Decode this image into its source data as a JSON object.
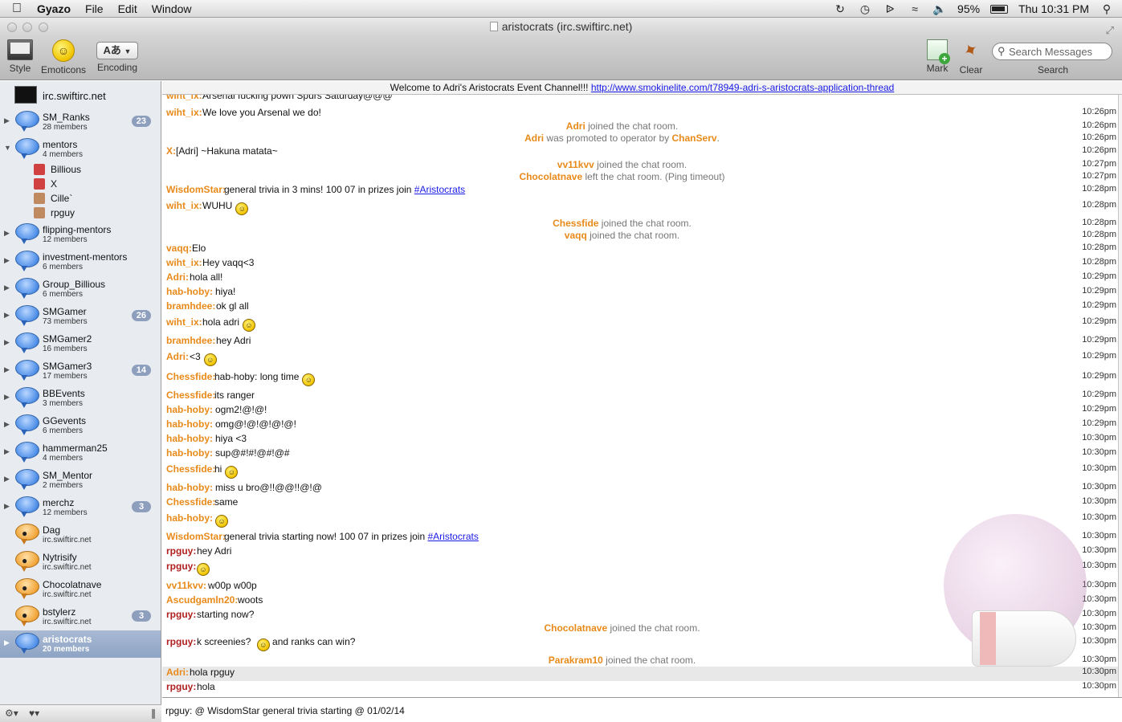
{
  "menubar": {
    "app": "Gyazo",
    "menus": [
      "File",
      "Edit",
      "Window"
    ],
    "battery": "95%",
    "clock": "Thu 10:31 PM"
  },
  "window": {
    "title": "aristocrats (irc.swiftirc.net)"
  },
  "toolbar": {
    "style": "Style",
    "emoticons": "Emoticons",
    "encoding_btn": "Aあ",
    "encoding": "Encoding",
    "mark": "Mark",
    "clear": "Clear",
    "search_placeholder": "Search Messages",
    "search": "Search"
  },
  "sidebar": {
    "server": "irc.swiftirc.net",
    "channels": [
      {
        "name": "SM_Ranks",
        "sub": "28 members",
        "badge": "23"
      },
      {
        "name": "mentors",
        "sub": "4 members",
        "badge": ""
      },
      {
        "name": "flipping-mentors",
        "sub": "12 members",
        "badge": ""
      },
      {
        "name": "investment-mentors",
        "sub": "6 members",
        "badge": ""
      },
      {
        "name": "Group_Billious",
        "sub": "6 members",
        "badge": ""
      },
      {
        "name": "SMGamer",
        "sub": "73 members",
        "badge": "26"
      },
      {
        "name": "SMGamer2",
        "sub": "16 members",
        "badge": ""
      },
      {
        "name": "SMGamer3",
        "sub": "17 members",
        "badge": "14"
      },
      {
        "name": "BBEvents",
        "sub": "3 members",
        "badge": ""
      },
      {
        "name": "GGevents",
        "sub": "6 members",
        "badge": ""
      },
      {
        "name": "hammerman25",
        "sub": "4 members",
        "badge": ""
      },
      {
        "name": "SM_Mentor",
        "sub": "2 members",
        "badge": ""
      },
      {
        "name": "merchz",
        "sub": "12 members",
        "badge": "3"
      },
      {
        "name": "Dag",
        "sub": "irc.swiftirc.net",
        "badge": ""
      },
      {
        "name": "Nytrisify",
        "sub": "irc.swiftirc.net",
        "badge": ""
      },
      {
        "name": "Chocolatnave",
        "sub": "irc.swiftirc.net",
        "badge": ""
      },
      {
        "name": "bstylerz",
        "sub": "irc.swiftirc.net",
        "badge": "3"
      },
      {
        "name": "aristocrats",
        "sub": "20 members",
        "badge": ""
      }
    ],
    "members": [
      "Billious",
      "X",
      "Cille`",
      "rpguy"
    ]
  },
  "topic": {
    "text": "Welcome to Adri's Aristocrats Event Channel!!! ",
    "link": "http://www.smokinelite.com/t78949-adri-s-aristocrats-application-thread"
  },
  "chat": {
    "messages": [
      {
        "nick": "wiht_ix:",
        "text": "Arsenal fucking pown Spurs Saturday@@@",
        "ts": ""
      },
      {
        "nick": "wiht_ix:",
        "text": "We love you Arsenal we do!",
        "ts": "10:26pm"
      },
      {
        "event_nick": "Adri",
        "event": " joined the chat room.",
        "ts": "10:26pm"
      },
      {
        "event_nick": "Adri",
        "event": " was promoted to operator by ",
        "event_nick2": "ChanServ",
        "event_end": ".",
        "ts": "10:26pm"
      },
      {
        "nick": "X:",
        "text": "[Adri] ~Hakuna matata~",
        "ts": "10:26pm"
      },
      {
        "event_nick": "vv11kvv",
        "event": " joined the chat room.",
        "ts": "10:27pm"
      },
      {
        "event_nick": "Chocolatnave",
        "event": " left the chat room. (Ping timeout)",
        "ts": "10:27pm"
      },
      {
        "nick": "WisdomStar:",
        "text": "general trivia in 3 mins! 100 07 in prizes join ",
        "link": "#Aristocrats",
        "ts": "10:28pm"
      },
      {
        "nick": "wiht_ix:",
        "text": "WUHU",
        "ts": "10:28pm"
      },
      {
        "event_nick": "Chessfide",
        "event": " joined the chat room.",
        "ts": "10:28pm"
      },
      {
        "event_nick": "vaqq",
        "event": " joined the chat room.",
        "ts": "10:28pm"
      },
      {
        "nick": "vaqq:",
        "text": "Elo",
        "ts": "10:28pm"
      },
      {
        "nick": "wiht_ix:",
        "text": "Hey vaqq<3",
        "ts": "10:28pm"
      },
      {
        "nick": "Adri:",
        "text": "hola all!",
        "ts": "10:29pm"
      },
      {
        "nick": "hab-hoby:",
        "text": "hiya!",
        "ts": "10:29pm"
      },
      {
        "nick": "bramhdee:",
        "text": "ok gl all",
        "ts": "10:29pm"
      },
      {
        "nick": "wiht_ix:",
        "text": "hola adri",
        "ts": "10:29pm"
      },
      {
        "nick": "bramhdee:",
        "text": "hey Adri",
        "ts": "10:29pm"
      },
      {
        "nick": "Adri:",
        "text": "<3",
        "ts": "10:29pm"
      },
      {
        "nick": "Chessfide:",
        "text": "hab-hoby: long time",
        "ts": "10:29pm"
      },
      {
        "nick": "Chessfide:",
        "text": "its ranger",
        "ts": "10:29pm"
      },
      {
        "nick": "hab-hoby:",
        "text": "ogm2!@!@!",
        "ts": "10:29pm"
      },
      {
        "nick": "hab-hoby:",
        "text": "omg@!@!@!@!@!",
        "ts": "10:29pm"
      },
      {
        "nick": "hab-hoby:",
        "text": "hiya <3",
        "ts": "10:30pm"
      },
      {
        "nick": "hab-hoby:",
        "text": "sup@#!#!@#!@#",
        "ts": "10:30pm"
      },
      {
        "nick": "Chessfide:",
        "text": "hi",
        "ts": "10:30pm"
      },
      {
        "nick": "hab-hoby:",
        "text": "miss u bro@!!@@!!@!@",
        "ts": "10:30pm"
      },
      {
        "nick": "Chessfide:",
        "text": "same",
        "ts": "10:30pm"
      },
      {
        "nick": "hab-hoby:",
        "text": "",
        "ts": "10:30pm"
      },
      {
        "nick": "WisdomStar:",
        "text": "general trivia starting now! 100 07 in prizes join ",
        "link": "#Aristocrats",
        "ts": "10:30pm"
      },
      {
        "nick": "rpguy:",
        "text": "hey Adri",
        "ts": "10:30pm"
      },
      {
        "nick": "rpguy:",
        "text": "",
        "ts": "10:30pm"
      },
      {
        "nick": "vv11kvv:",
        "text": "w00p w00p",
        "ts": "10:30pm"
      },
      {
        "nick": "Ascudgamln20:",
        "text": "woots",
        "ts": "10:30pm"
      },
      {
        "nick": "rpguy:",
        "text": "starting now?",
        "ts": "10:30pm"
      },
      {
        "event_nick": "Chocolatnave",
        "event": " joined the chat room.",
        "ts": "10:30pm"
      },
      {
        "nick": "rpguy:",
        "text": "k screenies? ",
        "text2": " and ranks can win?",
        "ts": "10:30pm"
      },
      {
        "event_nick": "Parakram10",
        "event": " joined the chat room.",
        "ts": "10:30pm"
      },
      {
        "nick": "Adri:",
        "text": "hola rpguy",
        "ts": "10:30pm"
      },
      {
        "nick": "rpguy:",
        "text": "hola",
        "ts": "10:30pm"
      }
    ]
  },
  "input": {
    "value": "rpguy: @ WisdomStar general trivia starting @ 01/02/14"
  }
}
